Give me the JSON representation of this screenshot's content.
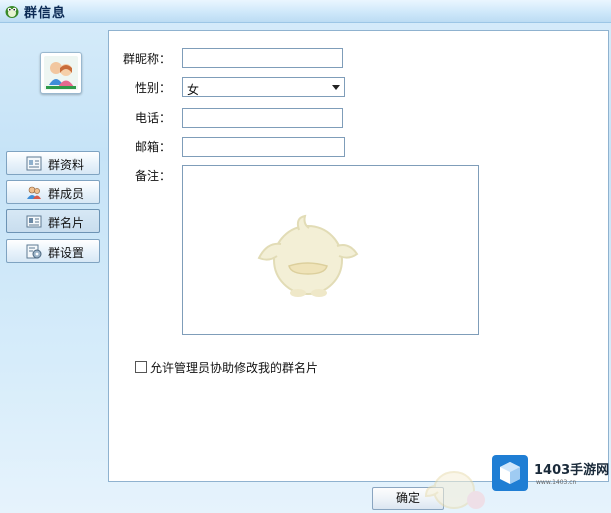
{
  "window": {
    "title": "群信息"
  },
  "nav": {
    "items": [
      {
        "label": "群资料",
        "icon": "group-info-icon"
      },
      {
        "label": "群成员",
        "icon": "group-members-icon"
      },
      {
        "label": "群名片",
        "icon": "group-card-icon",
        "active": true
      },
      {
        "label": "群设置",
        "icon": "group-settings-icon"
      }
    ]
  },
  "form": {
    "nickname": {
      "label": "群昵称：",
      "value": ""
    },
    "gender": {
      "label": "性别：",
      "value": "女"
    },
    "phone": {
      "label": "电话：",
      "value": ""
    },
    "email": {
      "label": "邮箱：",
      "value": ""
    },
    "notes": {
      "label": "备注：",
      "value": ""
    },
    "allow_admin": {
      "label": "允许管理员协助修改我的群名片",
      "checked": false
    }
  },
  "footer": {
    "ok_label": "确定"
  },
  "watermark": {
    "title": "1403手游网",
    "url": "www.1403.cn"
  }
}
